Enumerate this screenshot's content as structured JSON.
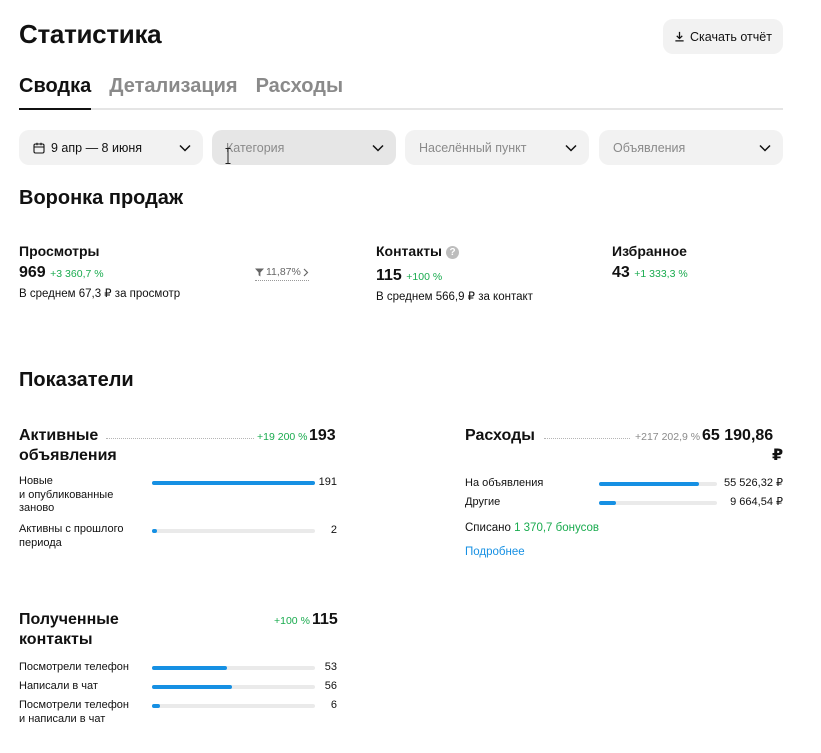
{
  "header": {
    "title": "Статистика",
    "download_label": "Скачать отчёт"
  },
  "tabs": [
    {
      "label": "Сводка",
      "active": true
    },
    {
      "label": "Детализация",
      "active": false
    },
    {
      "label": "Расходы",
      "active": false
    }
  ],
  "filters": {
    "date": "9 апр — 8 июня",
    "category_placeholder": "Категория",
    "city_placeholder": "Населённый пункт",
    "ads_placeholder": "Объявления"
  },
  "funnel": {
    "title": "Воронка продаж",
    "views": {
      "label": "Просмотры",
      "value": "969",
      "change": "+3 360,7 %",
      "note": "В среднем 67,3 ₽ за просмотр",
      "conversion": "11,87%"
    },
    "contacts": {
      "label": "Контакты",
      "value": "115",
      "change": "+100 %",
      "note": "В среднем 566,9 ₽ за контакт"
    },
    "favorites": {
      "label": "Избранное",
      "value": "43",
      "change": "+1 333,3 %"
    }
  },
  "indicators": {
    "title": "Показатели",
    "active_ads": {
      "title_line1": "Активные",
      "title_line2": "объявления",
      "change": "+19 200 %",
      "value": "193",
      "rows": [
        {
          "label1": "Новые",
          "label2": "и опубликованные",
          "label3": "заново",
          "value": "191",
          "ratio": 1.0
        },
        {
          "label1": "Активны с прошлого",
          "label2": "периода",
          "value": "2",
          "ratio": 0.03
        }
      ]
    },
    "expenses": {
      "title": "Расходы",
      "change": "+217 202,9 %",
      "value_line1": "65 190,86",
      "value_line2": "₽",
      "rows": [
        {
          "label": "На объявления",
          "value": "55 526,32 ₽",
          "ratio": 0.85
        },
        {
          "label": "Другие",
          "value": "9 664,54 ₽",
          "ratio": 0.14
        }
      ],
      "written_off_label": "Списано",
      "written_off_value": "1 370,7 бонусов",
      "more_link": "Подробнее"
    },
    "contacts": {
      "title_line1": "Полученные",
      "title_line2": "контакты",
      "change": "+100 %",
      "value": "115",
      "rows": [
        {
          "label1": "Посмотрели телефон",
          "value": "53",
          "ratio": 0.46
        },
        {
          "label1": "Написали в чат",
          "value": "56",
          "ratio": 0.49
        },
        {
          "label1": "Посмотрели телефон",
          "label2": "и написали в чат",
          "value": "6",
          "ratio": 0.05
        }
      ]
    }
  },
  "colors": {
    "accent_blue": "#1690e3",
    "positive_green": "#1aab4f",
    "filter_bg": "#f2f2f2"
  }
}
